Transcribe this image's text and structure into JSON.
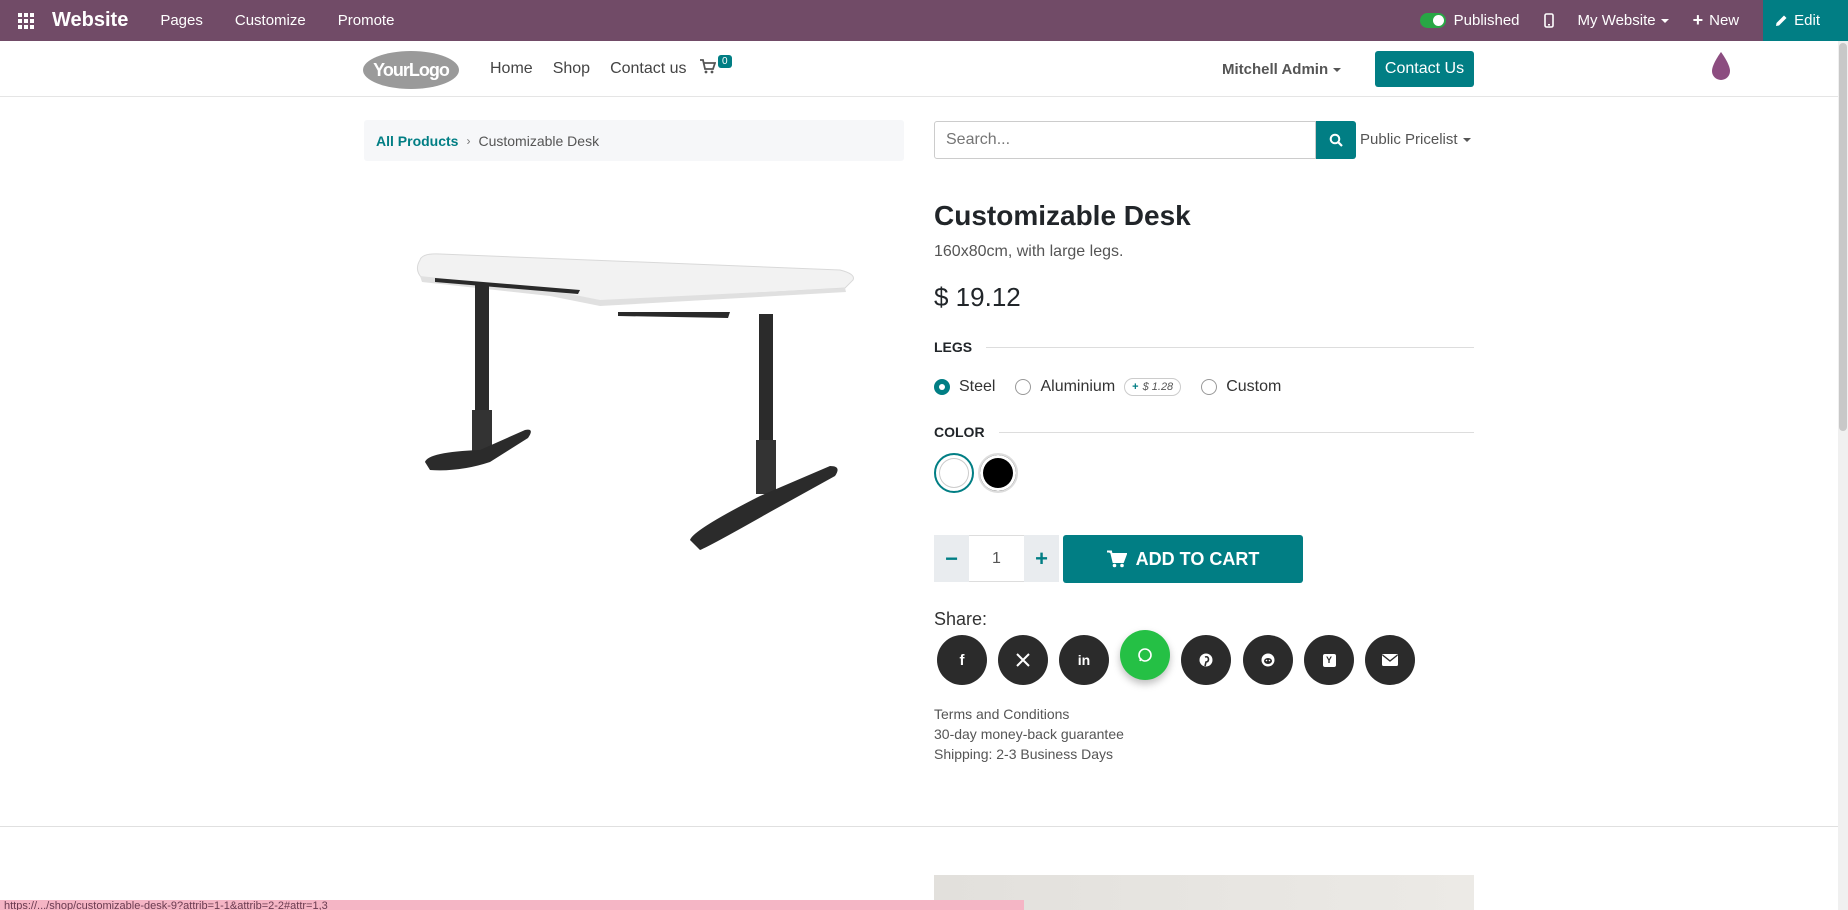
{
  "topbar": {
    "brand": "Website",
    "menus": [
      "Pages",
      "Customize",
      "Promote"
    ],
    "published_label": "Published",
    "site_label": "My Website",
    "new_label": "New",
    "edit_label": "Edit",
    "accent": "#714b67"
  },
  "navbar": {
    "logo_text": "YourLogo",
    "links": [
      "Home",
      "Shop",
      "Contact us"
    ],
    "cart_count": "0",
    "user": "Mitchell Admin",
    "contact_button": "Contact Us"
  },
  "breadcrumb": {
    "root": "All Products",
    "current": "Customizable Desk"
  },
  "search": {
    "placeholder": "Search...",
    "pricelist": "Public Pricelist"
  },
  "product": {
    "title": "Customizable Desk",
    "description": "160x80cm, with large legs.",
    "price": "$ 19.12",
    "legs_label": "LEGS",
    "legs_options": [
      {
        "label": "Steel",
        "selected": true
      },
      {
        "label": "Aluminium",
        "extra_sign": "+",
        "extra": "$ 1.28",
        "selected": false
      },
      {
        "label": "Custom",
        "selected": false
      }
    ],
    "color_label": "COLOR",
    "colors": [
      {
        "name": "White",
        "hex": "#ffffff",
        "selected": true
      },
      {
        "name": "Black",
        "hex": "#000000",
        "selected": false
      }
    ],
    "quantity": "1",
    "add_to_cart": "ADD TO CART",
    "share_label": "Share:",
    "share_icons": [
      "facebook-icon",
      "x-icon",
      "linkedin-icon",
      "whatsapp-icon",
      "pinterest-icon",
      "reddit-icon",
      "hacker-news-icon",
      "email-icon"
    ],
    "terms": [
      "Terms and Conditions",
      "30-day money-back guarantee",
      "Shipping: 2-3 Business Days"
    ]
  },
  "status_bar": "https://.../shop/customizable-desk-9?attrib=1-1&attrib=2-2#attr=1,3",
  "colors": {
    "primary": "#017e84",
    "brand": "#714b67"
  }
}
